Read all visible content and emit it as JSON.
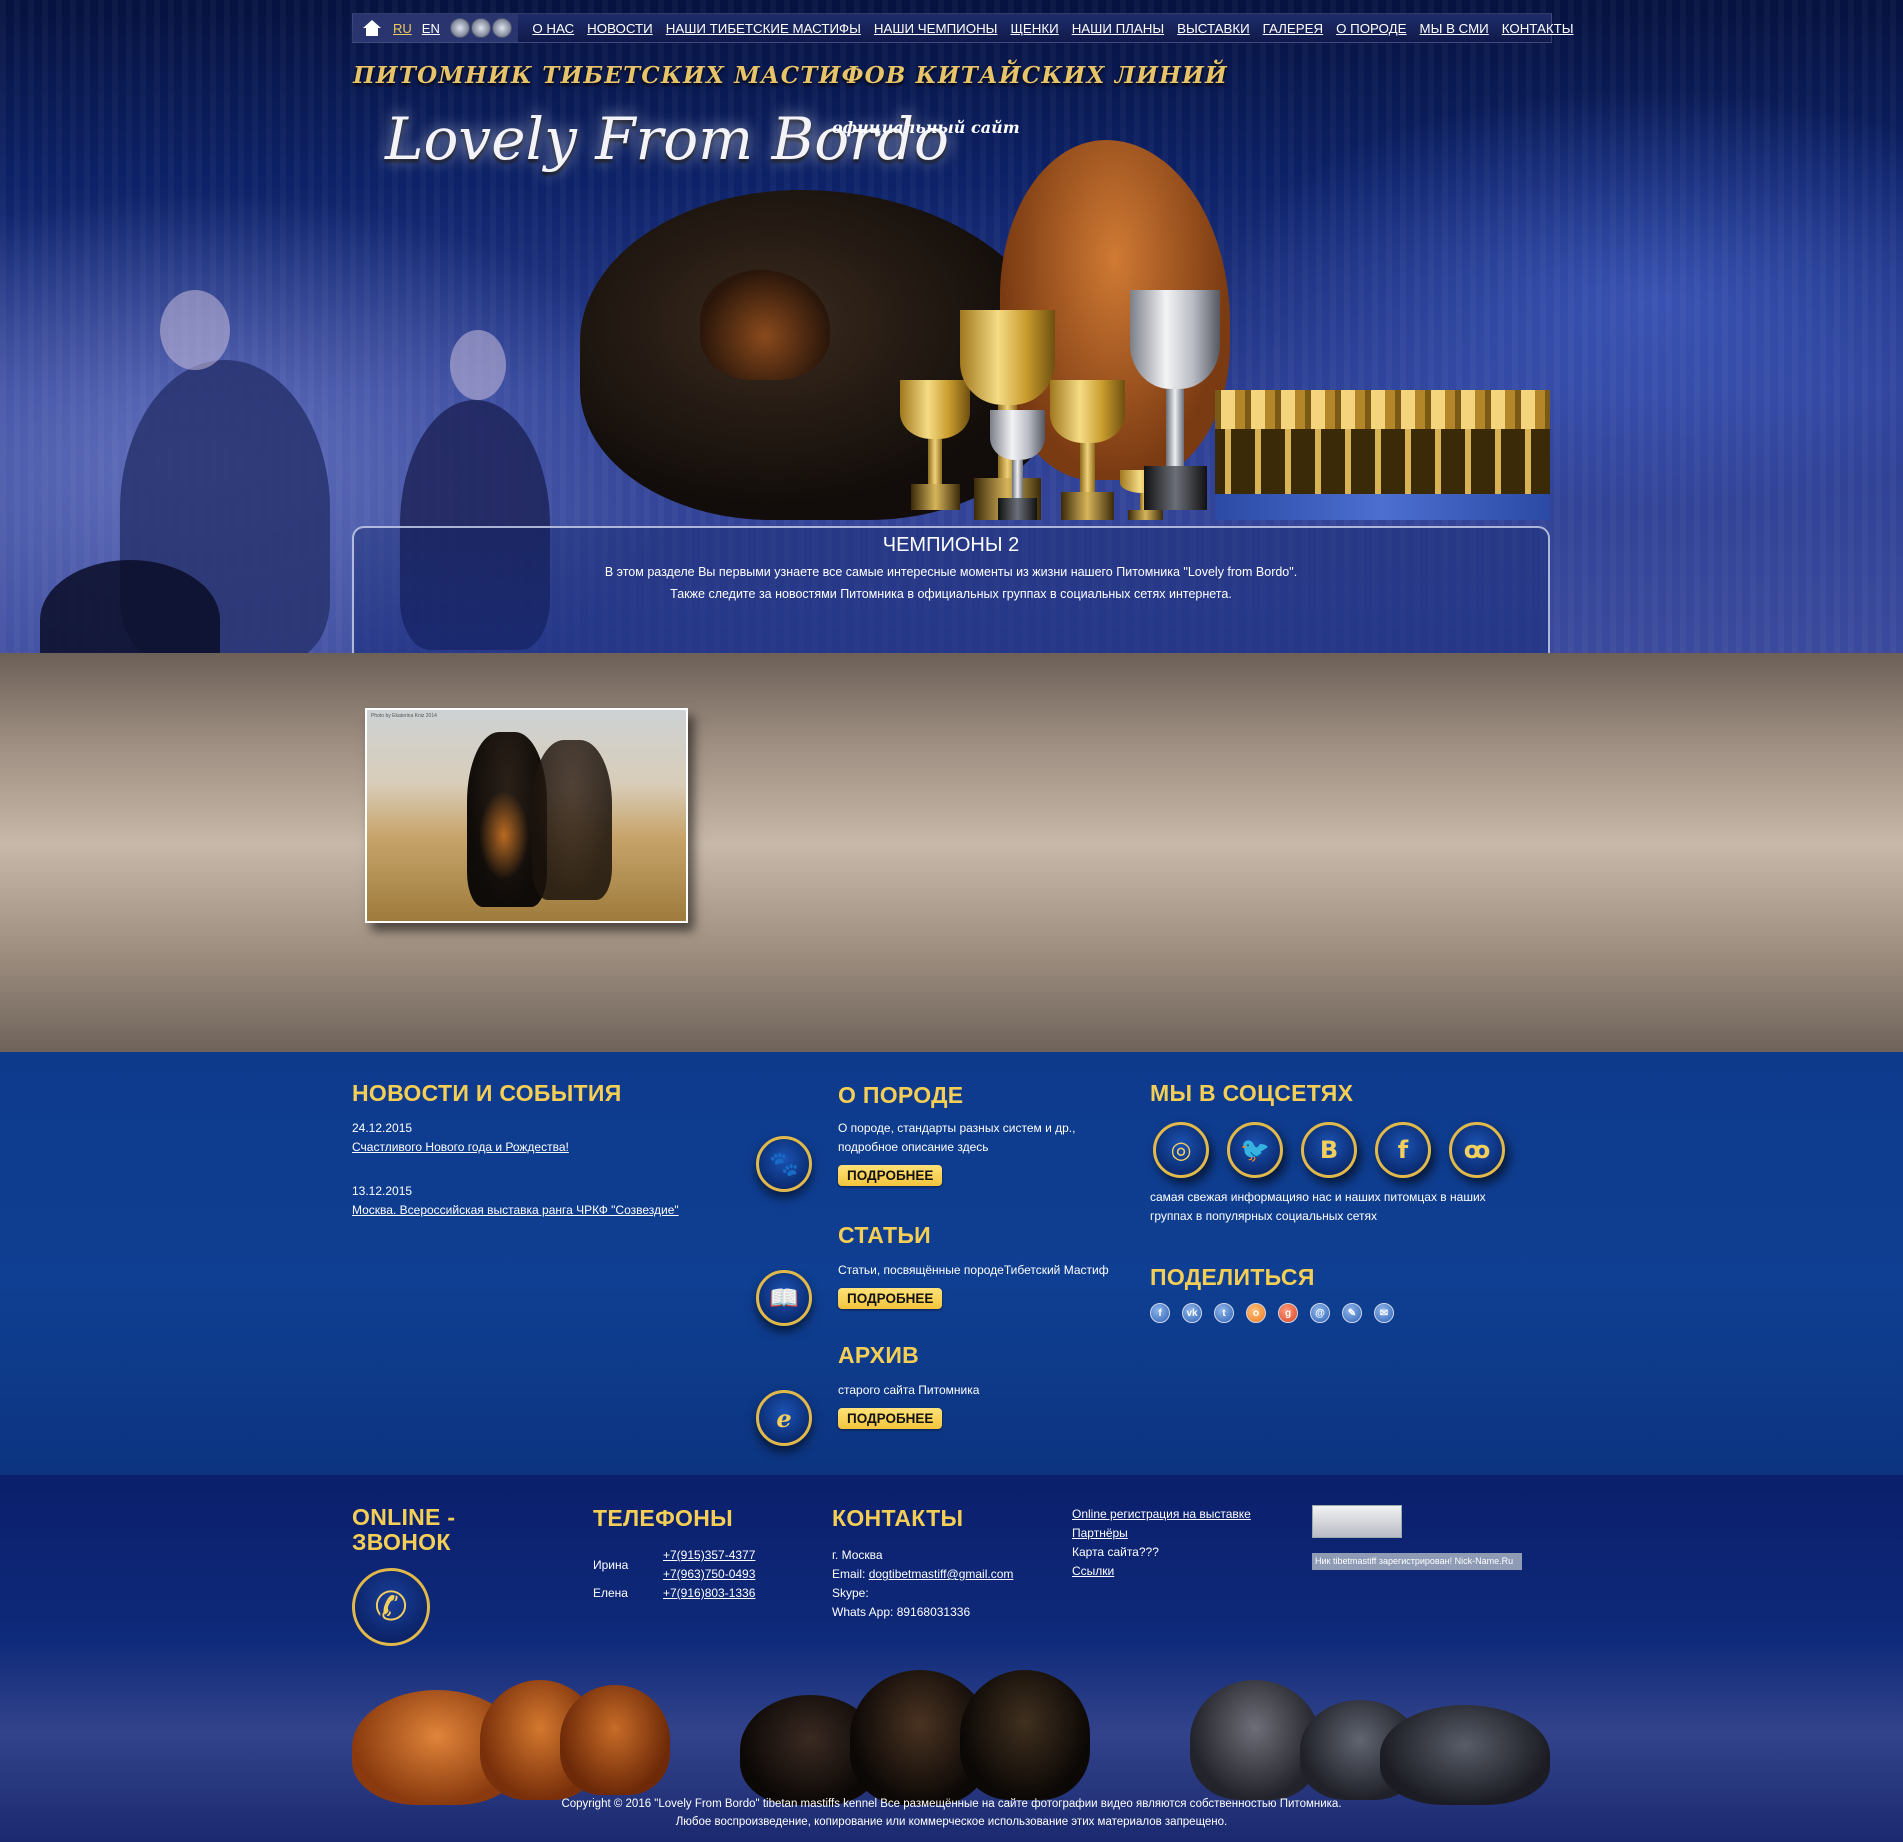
{
  "nav": {
    "langs": [
      "RU",
      "EN"
    ],
    "active_lang": "RU",
    "items": [
      "О НАС",
      "НОВОСТИ",
      "НАШИ ТИБЕТСКИЕ МАСТИФЫ",
      "НАШИ ЧЕМПИОНЫ",
      "ЩЕНКИ",
      "НАШИ ПЛАНЫ",
      "ВЫСТАВКИ",
      "ГАЛЕРЕЯ",
      "О ПОРОДЕ",
      "МЫ В СМИ",
      "КОНТАКТЫ"
    ]
  },
  "header": {
    "kennel_line": "ПИТОМНИК ТИБЕТСКИХ МАСТИФОВ КИТАЙСКИХ ЛИНИЙ",
    "logo": "Lovely From Bordo",
    "official": "официальный сайт"
  },
  "intro": {
    "title": "ЧЕМПИОНЫ 2",
    "line1": "В этом разделе Вы первыми узнаете все самые интересные моменты из жизни нашего Питомника \"Lovely from Bordo\".",
    "line2": "Также следите за новостями Питомника в официальных группах в социальных сетях интернета."
  },
  "gallery": {
    "caption": "Photo by Ekaterina Kniz 2014"
  },
  "news": {
    "title": "НОВОСТИ И СОБЫТИЯ",
    "items": [
      {
        "date": "24.12.2015",
        "text": "Счастливого Нового года и Рождества!"
      },
      {
        "date": "13.12.2015",
        "text": "Москва. Всероссийская выставка ранга ЧРКФ \"Созвездие\""
      }
    ]
  },
  "breed": {
    "title": "О ПОРОДЕ",
    "text1": "О породе, стандарты разных систем и др.,",
    "text2": "подробное описание здесь",
    "button": "ПОДРОБНЕЕ"
  },
  "articles": {
    "title": "СТАТЬИ",
    "text": "Статьи, посвящённые породеТибетский Мастиф",
    "button": "ПОДРОБНЕЕ"
  },
  "archive": {
    "title": "АРХИВ",
    "text": "старого сайта Питомника",
    "button": "ПОДРОБНЕЕ"
  },
  "social": {
    "title": "МЫ В СОЦСЕТЯХ",
    "icons": [
      "instagram-icon",
      "twitter-icon",
      "vk-icon",
      "facebook-icon",
      "odnoklassniki-icon"
    ],
    "text1": "самая свежая информацияо нас и наших питомцах в наших",
    "text2": "группах в популярных социальных сетях"
  },
  "share": {
    "title": "ПОДЕЛИТЬСЯ",
    "icons": [
      "facebook-share-icon",
      "vk-share-icon",
      "twitter-share-icon",
      "odnoklassniki-share-icon",
      "googleplus-share-icon",
      "mailru-share-icon",
      "livejournal-share-icon",
      "email-share-icon"
    ]
  },
  "footer": {
    "call_title1": "ONLINE -",
    "call_title2": "ЗВОНОК",
    "phones_title": "ТЕЛЕФОНЫ",
    "phones": [
      {
        "name": "Ирина",
        "numbers": [
          "+7(915)357-4377",
          "+7(963)750-0493"
        ]
      },
      {
        "name": "Елена",
        "numbers": [
          "+7(916)803-1336"
        ]
      }
    ],
    "contacts_title": "КОНТАКТЫ",
    "city": "г. Москва",
    "email_label": "Email:",
    "email": "dogtibetmastiff@gmail.com",
    "skype": "Skype:",
    "whatsapp": "Whats App: 89168031336",
    "links": [
      "Online регистрация на выставке",
      "Партнёры",
      "Карта сайта???",
      "Ссылки"
    ],
    "nick_badge": "Ник tibetmastiff зарегистрирован! Nick-Name.Ru",
    "copyright1": "Copyright © 2016 \"Lovely From Bordo\" tibetan mastiffs kennel Все размещённые на сайте фотографии видео являются собственностью Питомника.",
    "copyright2": "Любое воспроизведение, копирование или коммерческое использование этих материалов запрещено."
  },
  "colors": {
    "accent": "#f5cf55",
    "info_bg": "#0f3f92",
    "footer_bg": "#0b1f6c"
  }
}
